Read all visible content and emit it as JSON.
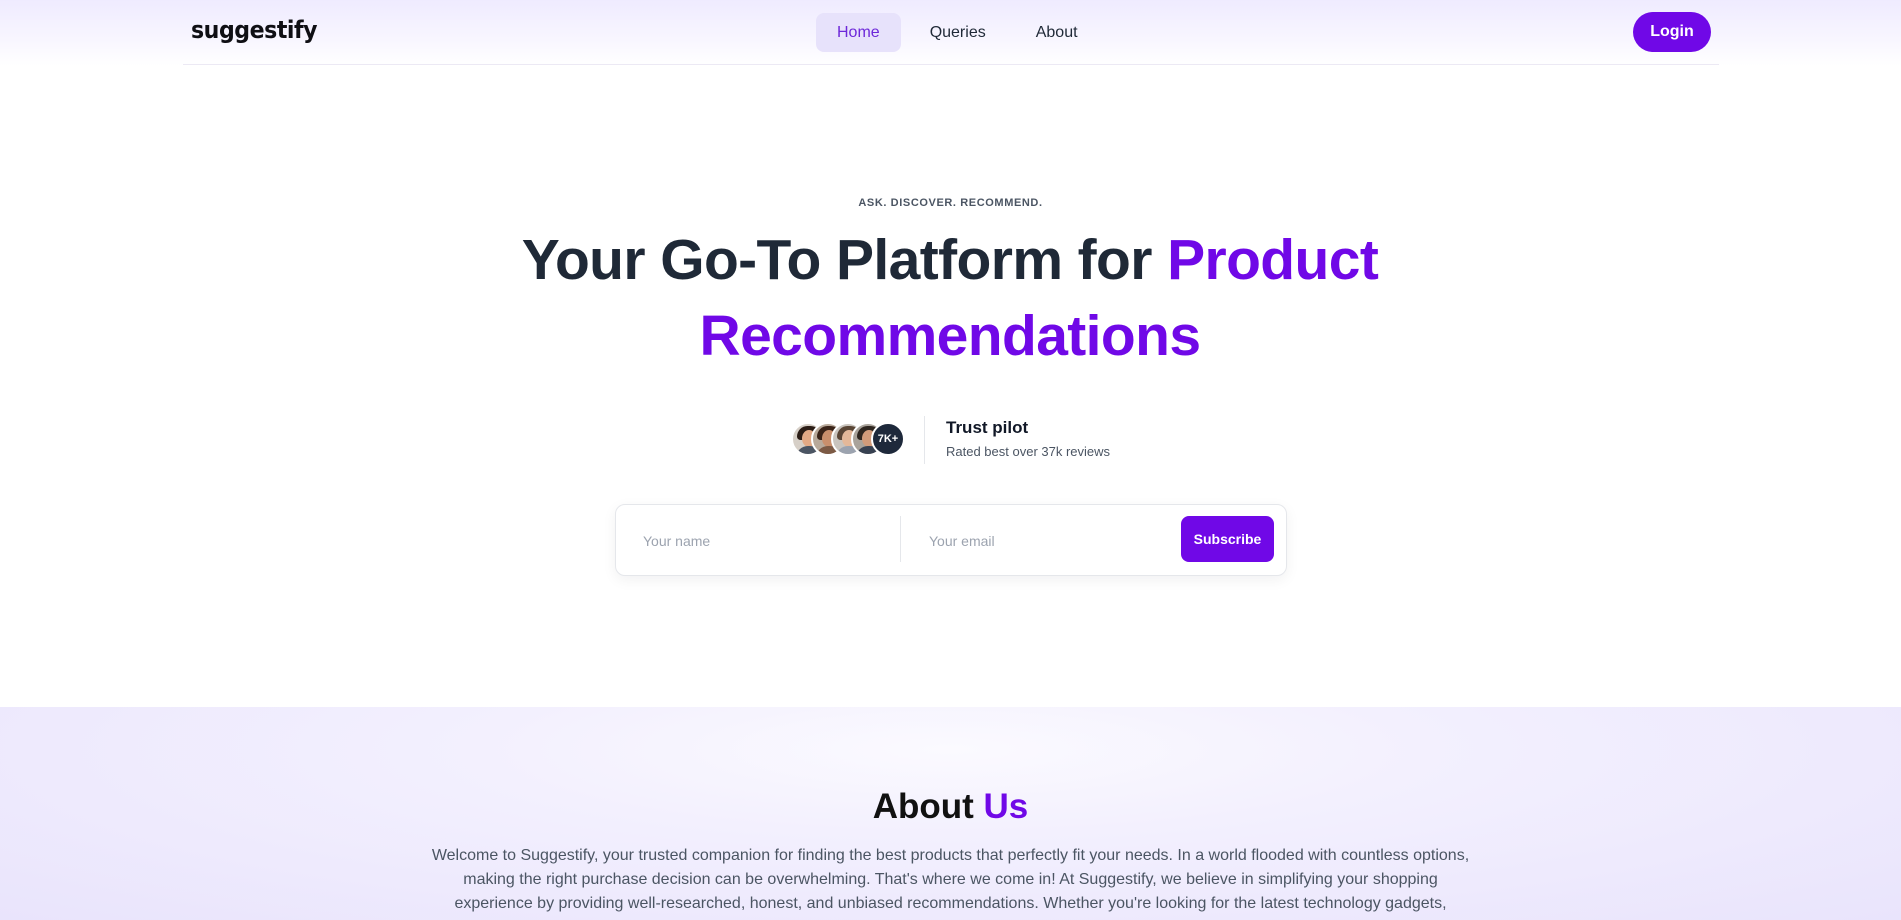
{
  "header": {
    "logo": "suggestify",
    "nav": [
      {
        "label": "Home",
        "active": true
      },
      {
        "label": "Queries",
        "active": false
      },
      {
        "label": "About",
        "active": false
      }
    ],
    "login_label": "Login"
  },
  "hero": {
    "eyebrow": "ASK. DISCOVER. RECOMMEND.",
    "title_part1": "Your Go-To Platform for ",
    "title_accent": "Product Recommendations",
    "trust": {
      "badge": "7K+",
      "title": "Trust pilot",
      "subtitle": "Rated best over 37k reviews"
    },
    "form": {
      "name_placeholder": "Your name",
      "email_placeholder": "Your email",
      "button_label": "Subscribe"
    }
  },
  "about": {
    "title_part1": "About ",
    "title_accent": "Us",
    "text": "Welcome to Suggestify, your trusted companion for finding the best products that perfectly fit your needs. In a world flooded with countless options, making the right purchase decision can be overwhelming. That's where we come in! At Suggestify, we believe in simplifying your shopping experience by providing well-researched, honest, and unbiased recommendations. Whether you're looking for the latest technology gadgets, essential home appliances,"
  },
  "colors": {
    "accent": "#7008e7",
    "nav_active_bg": "#e7e2fb",
    "heading": "#1f2937"
  }
}
